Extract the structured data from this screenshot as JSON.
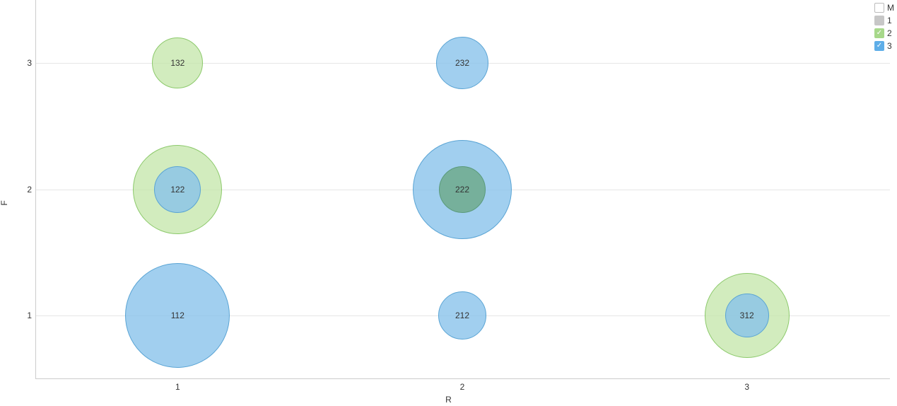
{
  "chart_data": {
    "type": "scatter",
    "xlabel": "R",
    "ylabel": "F",
    "x_ticks": [
      1,
      2,
      3
    ],
    "y_ticks": [
      1,
      2,
      3
    ],
    "xlim": [
      0.5,
      3.5
    ],
    "ylim": [
      0.5,
      3.5
    ],
    "legend": {
      "title": "M",
      "items": [
        {
          "name": "1",
          "color": "#c7c7c7",
          "selected": false
        },
        {
          "name": "2",
          "color": "#a7d88a",
          "selected": true
        },
        {
          "name": "3",
          "color": "#5eaee8",
          "selected": true
        }
      ]
    },
    "series": [
      {
        "name": "2",
        "color": "#c3e5a8",
        "points": [
          {
            "x": 1,
            "y": 3,
            "size": 72,
            "label": "132"
          },
          {
            "x": 1,
            "y": 2,
            "size": 126,
            "label": "122"
          },
          {
            "x": 3,
            "y": 1,
            "size": 120,
            "label": "312"
          }
        ]
      },
      {
        "name": "3",
        "color": "#87c2eb",
        "points": [
          {
            "x": 1,
            "y": 1,
            "size": 148,
            "label": "112"
          },
          {
            "x": 1,
            "y": 2,
            "size": 66,
            "label": "122"
          },
          {
            "x": 2,
            "y": 3,
            "size": 74,
            "label": "232"
          },
          {
            "x": 2,
            "y": 2,
            "size": 140,
            "label": "222"
          },
          {
            "x": 2,
            "y": 2,
            "size": 66,
            "label": "222",
            "nested": true
          },
          {
            "x": 2,
            "y": 1,
            "size": 68,
            "label": "212"
          },
          {
            "x": 3,
            "y": 1,
            "size": 62,
            "label": "312"
          }
        ]
      }
    ],
    "visible_labels": [
      {
        "x": 1,
        "y": 3,
        "text": "132"
      },
      {
        "x": 1,
        "y": 2,
        "text": "122"
      },
      {
        "x": 1,
        "y": 1,
        "text": "112"
      },
      {
        "x": 2,
        "y": 3,
        "text": "232"
      },
      {
        "x": 2,
        "y": 2,
        "text": "222"
      },
      {
        "x": 2,
        "y": 1,
        "text": "212"
      },
      {
        "x": 3,
        "y": 1,
        "text": "312"
      }
    ]
  }
}
